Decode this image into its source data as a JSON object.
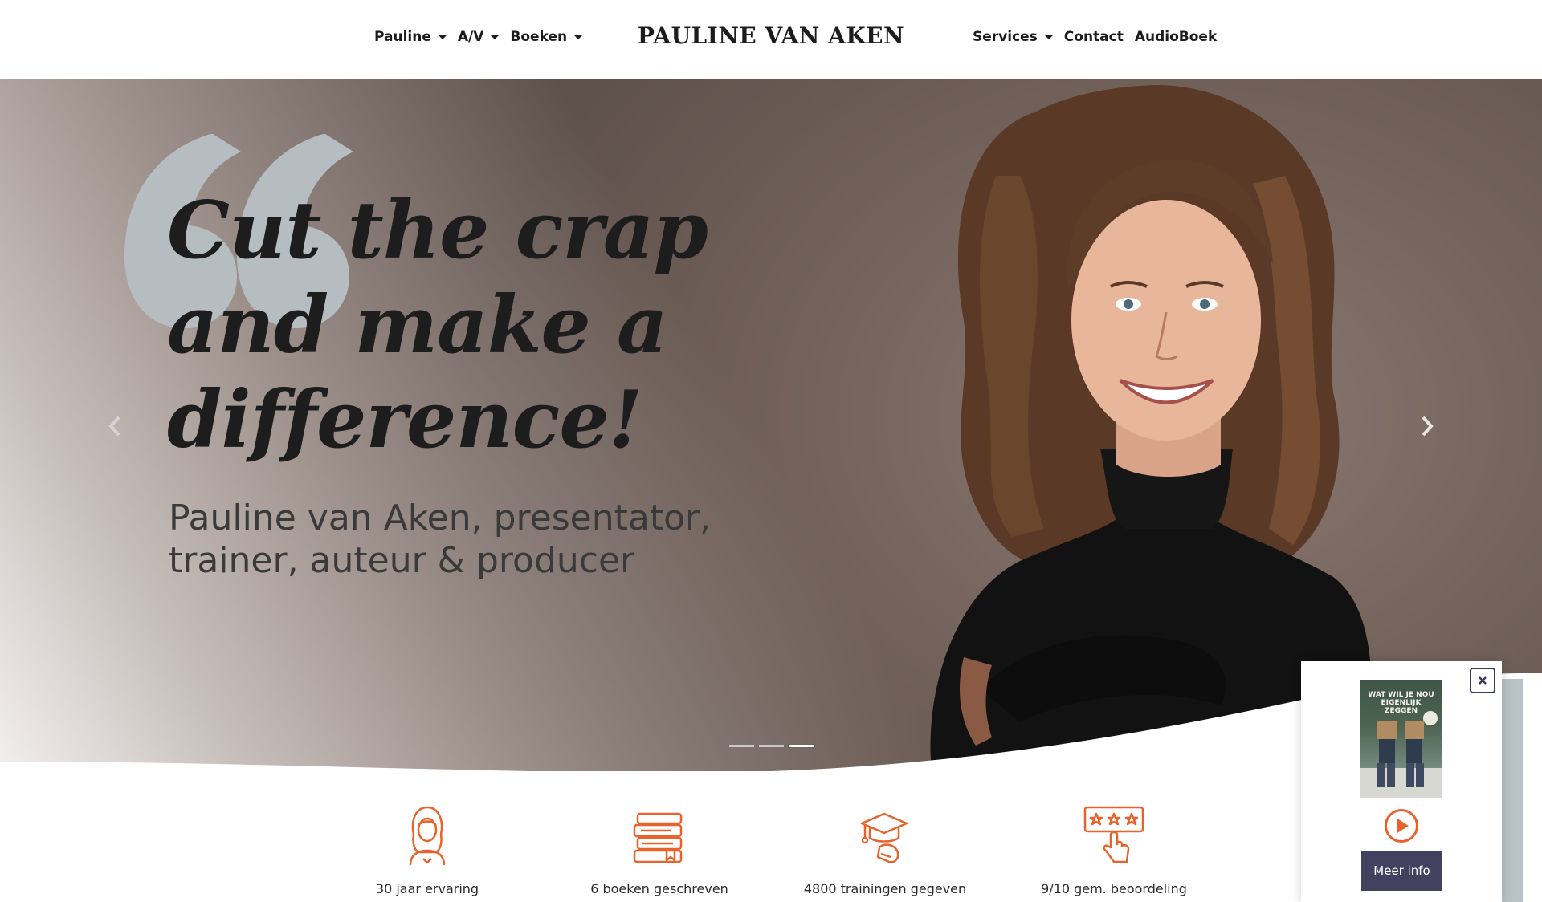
{
  "header": {
    "brand": "PAULINE VAN AKEN",
    "nav_left": [
      {
        "label": "Pauline",
        "dropdown": true
      },
      {
        "label": "A/V",
        "dropdown": true
      },
      {
        "label": "Boeken",
        "dropdown": true
      }
    ],
    "nav_right": [
      {
        "label": "Services",
        "dropdown": true
      },
      {
        "label": "Contact",
        "dropdown": false
      },
      {
        "label": "AudioBoek",
        "dropdown": false
      }
    ]
  },
  "hero": {
    "headline_lines": [
      "Cut the crap",
      "and make a",
      "difference!"
    ],
    "subline_lines": [
      "Pauline van Aken, presentator,",
      "trainer, auteur & producer"
    ],
    "slides_total": 3,
    "active_slide": 3,
    "prev_icon": "chevron-left-icon",
    "next_icon": "chevron-right-icon"
  },
  "stats": [
    {
      "icon": "woman-icon",
      "label": "30 jaar ervaring"
    },
    {
      "icon": "books-icon",
      "label": "6 boeken geschreven"
    },
    {
      "icon": "graduation-cap-icon",
      "label": "4800 trainingen gegeven"
    },
    {
      "icon": "rating-stars-icon",
      "label": "9/10 gem. beoordeling"
    }
  ],
  "popup": {
    "close_icon": "close-icon",
    "book_title": "WAT WIL JE NOU EIGENLIJK ZEGGEN",
    "play_icon": "play-icon",
    "button_label": "Meer info"
  },
  "colors": {
    "accent_orange": "#e8622c",
    "button_purple": "#44405f",
    "text_dark": "#1d1d1d",
    "quote_mark": "#b6bdc1"
  }
}
